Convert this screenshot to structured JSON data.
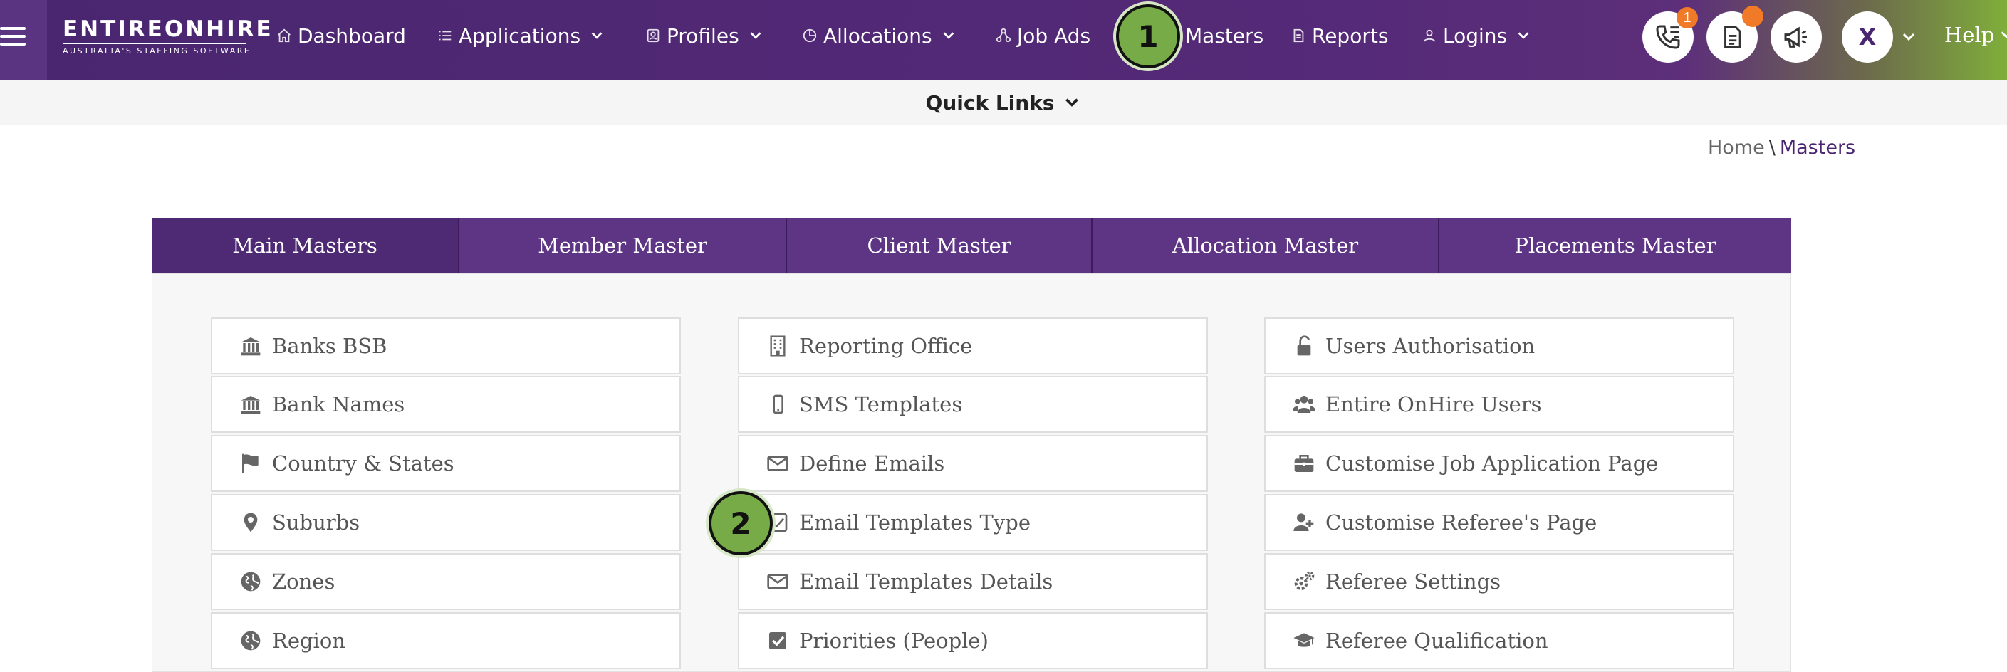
{
  "logo": {
    "main": "ENTIREONHIRE",
    "sub": "AUSTRALIA'S STAFFING SOFTWARE"
  },
  "nav": [
    {
      "label": "Dashboard",
      "icon": "home-icon",
      "dropdown": false
    },
    {
      "label": "Applications",
      "icon": "list-icon",
      "dropdown": true
    },
    {
      "label": "Profiles",
      "icon": "id-card-icon",
      "dropdown": true
    },
    {
      "label": "Allocations",
      "icon": "pie-icon",
      "dropdown": true
    },
    {
      "label": "Job Ads",
      "icon": "network-icon",
      "dropdown": true
    },
    {
      "label": "Masters",
      "icon": "none",
      "dropdown": false
    },
    {
      "label": "Reports",
      "icon": "document-icon",
      "dropdown": false
    },
    {
      "label": "Logins",
      "icon": "user-icon",
      "dropdown": true
    }
  ],
  "header_actions": {
    "phone_badge": "1",
    "user_initial": "X",
    "help_label": "Help"
  },
  "callouts": [
    "1",
    "2"
  ],
  "quick_links": {
    "label": "Quick Links"
  },
  "breadcrumb": {
    "home": "Home",
    "separator": "\\",
    "current": "Masters"
  },
  "tabs": [
    "Main Masters",
    "Member Master",
    "Client Master",
    "Allocation Master",
    "Placements Master"
  ],
  "columns": [
    [
      {
        "label": "Banks BSB",
        "icon": "bank-icon"
      },
      {
        "label": "Bank Names",
        "icon": "bank-icon"
      },
      {
        "label": "Country & States",
        "icon": "flag-icon"
      },
      {
        "label": "Suburbs",
        "icon": "map-marker-icon"
      },
      {
        "label": "Zones",
        "icon": "globe-icon"
      },
      {
        "label": "Region",
        "icon": "globe-icon"
      }
    ],
    [
      {
        "label": "Reporting Office",
        "icon": "building-icon"
      },
      {
        "label": "SMS Templates",
        "icon": "mobile-icon"
      },
      {
        "label": "Define Emails",
        "icon": "envelope-icon"
      },
      {
        "label": "Email Templates Type",
        "icon": "checkbox-outline-icon"
      },
      {
        "label": "Email Templates Details",
        "icon": "envelope-icon"
      },
      {
        "label": "Priorities (People)",
        "icon": "checkbox-checked-icon"
      }
    ],
    [
      {
        "label": "Users Authorisation",
        "icon": "unlock-icon"
      },
      {
        "label": "Entire OnHire Users",
        "icon": "users-icon"
      },
      {
        "label": "Customise Job Application Page",
        "icon": "briefcase-icon"
      },
      {
        "label": "Customise Referee's Page",
        "icon": "user-plus-icon"
      },
      {
        "label": "Referee Settings",
        "icon": "gears-icon"
      },
      {
        "label": "Referee Qualification",
        "icon": "graduation-cap-icon"
      }
    ]
  ],
  "colors": {
    "primary": "#4a2670",
    "tab": "#5e3585",
    "accent_green": "#76ab48",
    "badge": "#f07a28"
  }
}
